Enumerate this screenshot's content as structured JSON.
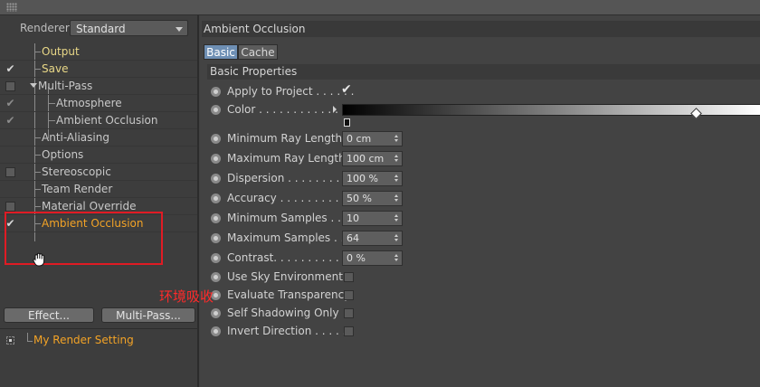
{
  "renderer": {
    "label": "Renderer",
    "value": "Standard"
  },
  "tree": [
    {
      "label": "Output",
      "check": "",
      "color": "yellow"
    },
    {
      "label": "Save",
      "check": "✔",
      "color": "yellow"
    },
    {
      "label": "Multi-Pass",
      "check": "box",
      "color": "gray"
    },
    {
      "label": "Atmosphere",
      "check": "✔",
      "color": "gray"
    },
    {
      "label": "Ambient Occlusion",
      "check": "✔",
      "color": "gray"
    },
    {
      "label": "Anti-Aliasing",
      "check": "",
      "color": "gray"
    },
    {
      "label": "Options",
      "check": "",
      "color": "gray"
    },
    {
      "label": "Stereoscopic",
      "check": "box",
      "color": "gray"
    },
    {
      "label": "Team Render",
      "check": "",
      "color": "gray"
    },
    {
      "label": "Material Override",
      "check": "box",
      "color": "gray"
    },
    {
      "label": "Ambient Occlusion",
      "check": "✔",
      "color": "orange"
    }
  ],
  "annotation": "环境吸收",
  "buttons": {
    "effect": "Effect...",
    "multipass": "Multi-Pass..."
  },
  "render_setting": "My Render Setting",
  "panel": {
    "title": "Ambient Occlusion",
    "tabs": {
      "basic": "Basic",
      "cache": "Cache"
    },
    "section": "Basic Properties"
  },
  "props": {
    "apply_to_project": {
      "label": "Apply to Project . . . . . .",
      "value": "✔"
    },
    "color": {
      "label": "Color . . . . . . . . . . . . . ."
    },
    "min_ray_length": {
      "label": "Minimum Ray Length",
      "value": "0 cm"
    },
    "max_ray_length": {
      "label": "Maximum Ray Length",
      "value": "100 cm"
    },
    "dispersion": {
      "label": "Dispersion . . . . . . . . . .",
      "value": "100 %"
    },
    "accuracy": {
      "label": "Accuracy . . . . . . . . . . .",
      "value": "50 %"
    },
    "min_samples": {
      "label": "Minimum Samples . . .",
      "value": "10"
    },
    "max_samples": {
      "label": "Maximum Samples . . .",
      "value": "64"
    },
    "contrast": {
      "label": "Contrast. . . . . . . . . . . .",
      "value": "0 %"
    },
    "use_sky": {
      "label": "Use Sky Environment"
    },
    "eval_transparency": {
      "label": "Evaluate Transparency"
    },
    "self_shadowing": {
      "label": "Self Shadowing Only"
    },
    "invert_direction": {
      "label": "Invert Direction . . . . . ."
    }
  },
  "colors": {
    "accent_orange": "#f3a326",
    "highlight_red": "#e01b24",
    "tab_active": "#6e8fb4"
  }
}
